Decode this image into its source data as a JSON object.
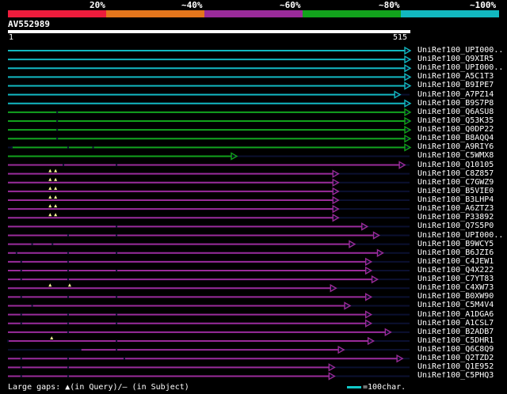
{
  "legend": {
    "labels": [
      "20%",
      "~40%",
      "~60%",
      "~80%",
      "~100%"
    ],
    "colors": [
      "#ee1c3c",
      "#e4761c",
      "#9a2b9a",
      "#12a21c",
      "#12b8c0"
    ]
  },
  "query": {
    "name": "AV552989",
    "start": "1",
    "end": "515"
  },
  "footer": {
    "gaps_prefix": "Large gaps: ",
    "query_glyph": "▲",
    "gaps_suffix": "(in Query)/– (in Subject)",
    "scale_text": "=100char."
  },
  "hits": [
    {
      "label": "UniRef100_UPI000..",
      "color": "#12b8c0",
      "start": 1,
      "end": 515,
      "ticks": [],
      "gaps": []
    },
    {
      "label": "UniRef100_Q9XIR5",
      "color": "#12b8c0",
      "start": 1,
      "end": 515,
      "ticks": [],
      "gaps": []
    },
    {
      "label": "UniRef100_UPI000..",
      "color": "#12b8c0",
      "start": 1,
      "end": 515,
      "ticks": [],
      "gaps": []
    },
    {
      "label": "UniRef100_A5C1T3",
      "color": "#12b8c0",
      "start": 1,
      "end": 515,
      "ticks": [],
      "gaps": []
    },
    {
      "label": "UniRef100_B9IPE7",
      "color": "#12b8c0",
      "start": 1,
      "end": 515,
      "ticks": [],
      "gaps": []
    },
    {
      "label": "UniRef100_A7PZ14",
      "color": "#12b8c0",
      "start": 1,
      "end": 502,
      "ticks": [],
      "gaps": []
    },
    {
      "label": "UniRef100_B9S7P8",
      "color": "#12b8c0",
      "start": 1,
      "end": 515,
      "ticks": [],
      "gaps": []
    },
    {
      "label": "UniRef100_Q6ASU8",
      "color": "#12a21c",
      "start": 1,
      "end": 515,
      "ticks": [
        64
      ],
      "gaps": []
    },
    {
      "label": "UniRef100_Q53K35",
      "color": "#12a21c",
      "start": 1,
      "end": 515,
      "ticks": [
        64
      ],
      "gaps": []
    },
    {
      "label": "UniRef100_Q0DP22",
      "color": "#12a21c",
      "start": 1,
      "end": 515,
      "ticks": [
        64
      ],
      "gaps": []
    },
    {
      "label": "UniRef100_B8AQQ4",
      "color": "#12a21c",
      "start": 1,
      "end": 515,
      "ticks": [
        64
      ],
      "gaps": []
    },
    {
      "label": "UniRef100_A9RIY6",
      "color": "#12a21c",
      "start": 6,
      "end": 515,
      "ticks": [
        6,
        78,
        110
      ],
      "gaps": []
    },
    {
      "label": "UniRef100_C5WMX8",
      "color": "#12a21c",
      "start": 1,
      "end": 293,
      "ticks": [],
      "gaps": []
    },
    {
      "label": "UniRef100_Q10105",
      "color": "#9a2b9a",
      "start": 1,
      "end": 508,
      "ticks": [
        72,
        140
      ],
      "gaps": []
    },
    {
      "label": "UniRef100_C8Z857",
      "color": "#9a2b9a",
      "start": 1,
      "end": 423,
      "ticks": [],
      "gaps": [
        55,
        62
      ]
    },
    {
      "label": "UniRef100_C7GWZ9",
      "color": "#9a2b9a",
      "start": 1,
      "end": 423,
      "ticks": [],
      "gaps": [
        55,
        62
      ]
    },
    {
      "label": "UniRef100_B5VIE0",
      "color": "#9a2b9a",
      "start": 1,
      "end": 423,
      "ticks": [],
      "gaps": [
        55,
        62
      ]
    },
    {
      "label": "UniRef100_B3LHP4",
      "color": "#9a2b9a",
      "start": 1,
      "end": 423,
      "ticks": [],
      "gaps": [
        55,
        62
      ]
    },
    {
      "label": "UniRef100_A6ZTZ3",
      "color": "#9a2b9a",
      "start": 1,
      "end": 423,
      "ticks": [],
      "gaps": [
        55,
        62
      ]
    },
    {
      "label": "UniRef100_P33892",
      "color": "#9a2b9a",
      "start": 1,
      "end": 423,
      "ticks": [],
      "gaps": [
        55,
        62
      ]
    },
    {
      "label": "UniRef100_Q7S5P0",
      "color": "#9a2b9a",
      "start": 1,
      "end": 460,
      "ticks": [
        140
      ],
      "gaps": []
    },
    {
      "label": "UniRef100_UPI000..",
      "color": "#9a2b9a",
      "start": 1,
      "end": 475,
      "ticks": [
        78,
        140
      ],
      "gaps": []
    },
    {
      "label": "UniRef100_B9WCY5",
      "color": "#9a2b9a",
      "start": 1,
      "end": 444,
      "ticks": [
        32,
        58
      ],
      "gaps": []
    },
    {
      "label": "UniRef100_B6JZI6",
      "color": "#9a2b9a",
      "start": 1,
      "end": 480,
      "ticks": [
        12,
        78,
        140
      ],
      "gaps": []
    },
    {
      "label": "UniRef100_C4JEW1",
      "color": "#9a2b9a",
      "start": 1,
      "end": 465,
      "ticks": [
        18,
        78
      ],
      "gaps": []
    },
    {
      "label": "UniRef100_Q4X222",
      "color": "#9a2b9a",
      "start": 1,
      "end": 465,
      "ticks": [
        18,
        78,
        140
      ],
      "gaps": []
    },
    {
      "label": "UniRef100_C7YT83",
      "color": "#9a2b9a",
      "start": 1,
      "end": 473,
      "ticks": [
        18,
        78
      ],
      "gaps": []
    },
    {
      "label": "UniRef100_C4XW73",
      "color": "#9a2b9a",
      "start": 1,
      "end": 420,
      "ticks": [],
      "gaps": [
        55,
        80
      ]
    },
    {
      "label": "UniRef100_B0XW90",
      "color": "#9a2b9a",
      "start": 1,
      "end": 465,
      "ticks": [
        18,
        78,
        140
      ],
      "gaps": []
    },
    {
      "label": "UniRef100_C5M4V4",
      "color": "#9a2b9a",
      "start": 1,
      "end": 438,
      "ticks": [
        32
      ],
      "gaps": []
    },
    {
      "label": "UniRef100_A1DGA6",
      "color": "#9a2b9a",
      "start": 1,
      "end": 465,
      "ticks": [
        18,
        78,
        140
      ],
      "gaps": []
    },
    {
      "label": "UniRef100_A1CSL7",
      "color": "#9a2b9a",
      "start": 1,
      "end": 465,
      "ticks": [
        18,
        78,
        140
      ],
      "gaps": []
    },
    {
      "label": "UniRef100_B2ADB7",
      "color": "#9a2b9a",
      "start": 1,
      "end": 490,
      "ticks": [
        78
      ],
      "gaps": []
    },
    {
      "label": "UniRef100_C5DHR1",
      "color": "#9a2b9a",
      "start": 1,
      "end": 468,
      "ticks": [
        1,
        140
      ],
      "gaps": [
        57
      ]
    },
    {
      "label": "UniRef100_Q6C8Q9",
      "color": "#9a2b9a",
      "start": 95,
      "end": 430,
      "ticks": [
        140
      ],
      "gaps": []
    },
    {
      "label": "UniRef100_Q2TZD2",
      "color": "#9a2b9a",
      "start": 1,
      "end": 505,
      "ticks": [
        18,
        78,
        150
      ],
      "gaps": []
    },
    {
      "label": "UniRef100_Q1E952",
      "color": "#9a2b9a",
      "start": 1,
      "end": 418,
      "ticks": [
        18,
        78
      ],
      "gaps": []
    },
    {
      "label": "UniRef100_C5PHQ3",
      "color": "#9a2b9a",
      "start": 1,
      "end": 418,
      "ticks": [
        18,
        78
      ],
      "gaps": []
    }
  ]
}
